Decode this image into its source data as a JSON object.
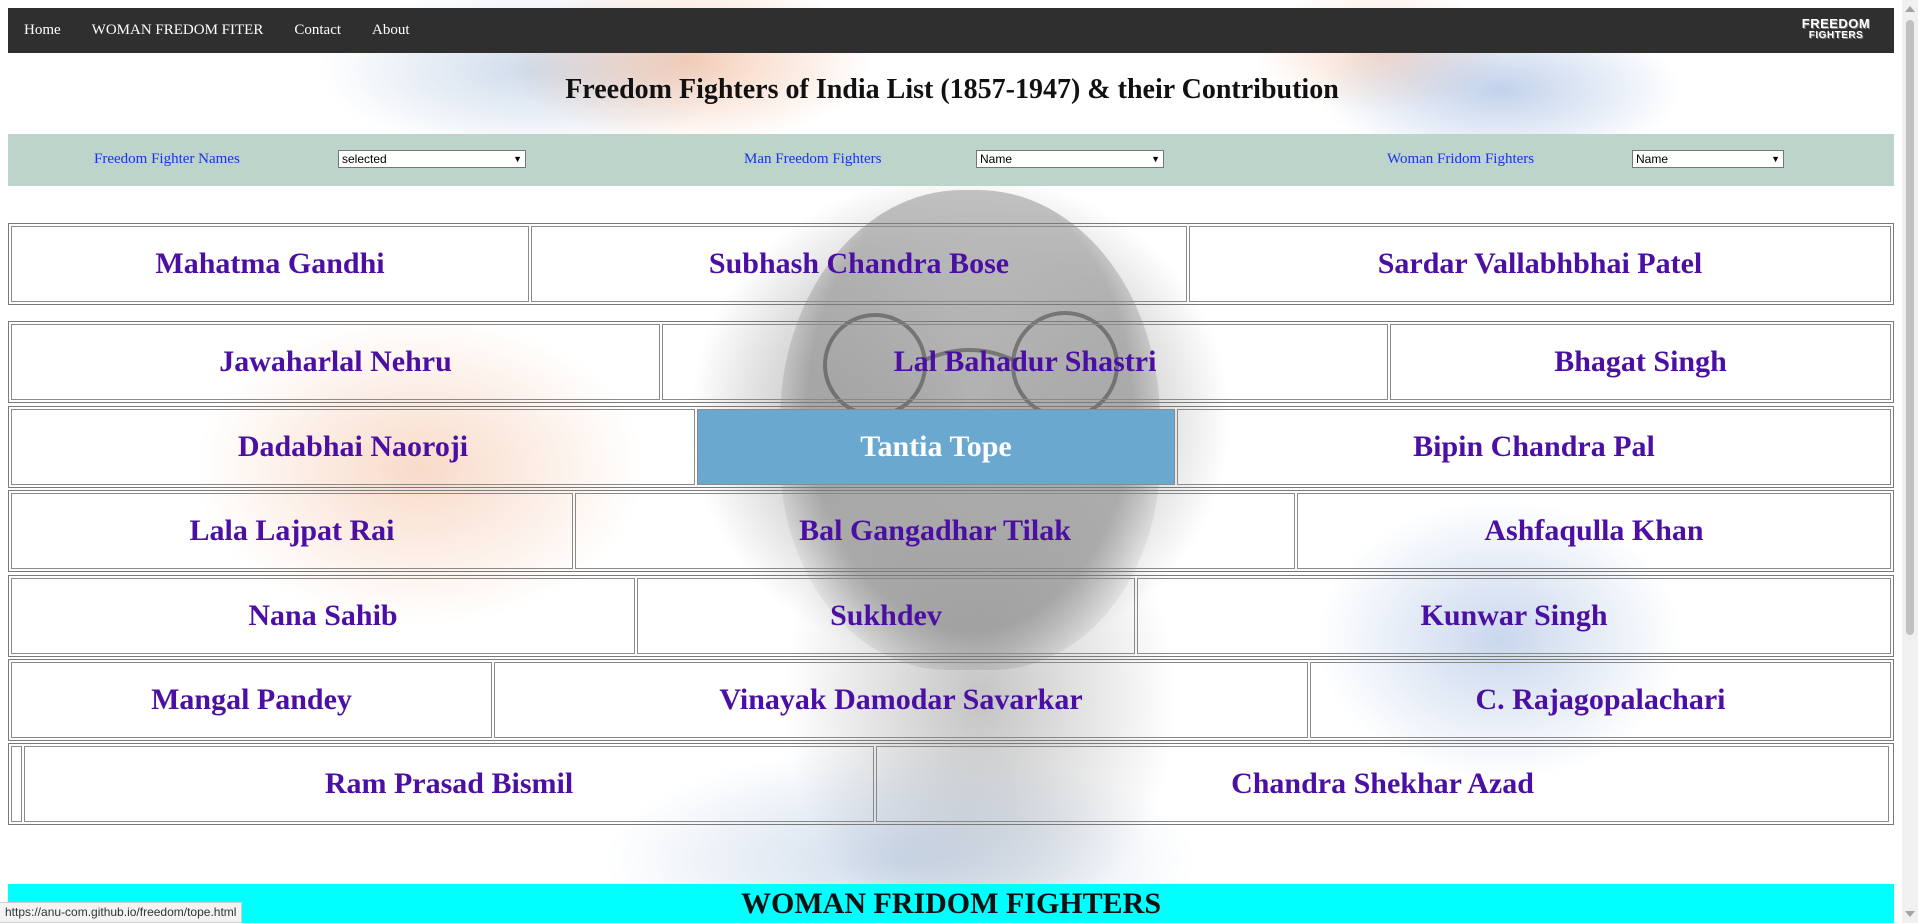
{
  "nav": {
    "items": [
      "Home",
      "WOMAN FREDOM FITER",
      "Contact",
      "About"
    ],
    "logo_line1": "FREEDOM",
    "logo_line2": "FIGHTERS"
  },
  "page_title": "Freedom Fighters of India List (1857-1947) & their Contribution",
  "filters": {
    "names_label": "Freedom Fighter Names",
    "names_selected": "selected",
    "man_label": "Man Freedom Fighters",
    "man_selected": "Name",
    "woman_label": "Woman Fridom Fighters",
    "woman_selected": "Name"
  },
  "rows": [
    [
      "Mahatma Gandhi",
      "Subhash Chandra Bose",
      "Sardar Vallabhbhai Patel"
    ],
    [
      "Jawaharlal Nehru",
      "Lal Bahadur Shastri",
      "Bhagat Singh"
    ],
    [
      "Dadabhai Naoroji",
      "Tantia Tope",
      "Bipin Chandra Pal"
    ],
    [
      "Lala Lajpat Rai",
      "Bal Gangadhar Tilak",
      "Ashfaqulla Khan"
    ],
    [
      "Nana Sahib",
      "Sukhdev",
      "Kunwar Singh"
    ],
    [
      "Mangal Pandey",
      "Vinayak Damodar Savarkar",
      "C. Rajagopalachari"
    ],
    [
      "Ram Prasad Bismil",
      "Chandra Shekhar Azad"
    ]
  ],
  "highlighted": "Tantia Tope",
  "women_section_title": "WOMAN FRIDOM FIGHTERS",
  "status_url": "https://anu-com.github.io/freedom/tope.html",
  "colors": {
    "nav_bg": "#2f2f2f",
    "filter_bg": "#bcd4c9",
    "name_text": "#4b0fa3",
    "highlight_bg": "#6ba8d0",
    "banner_bg": "#00ffff",
    "filter_label": "#1a33e8"
  }
}
